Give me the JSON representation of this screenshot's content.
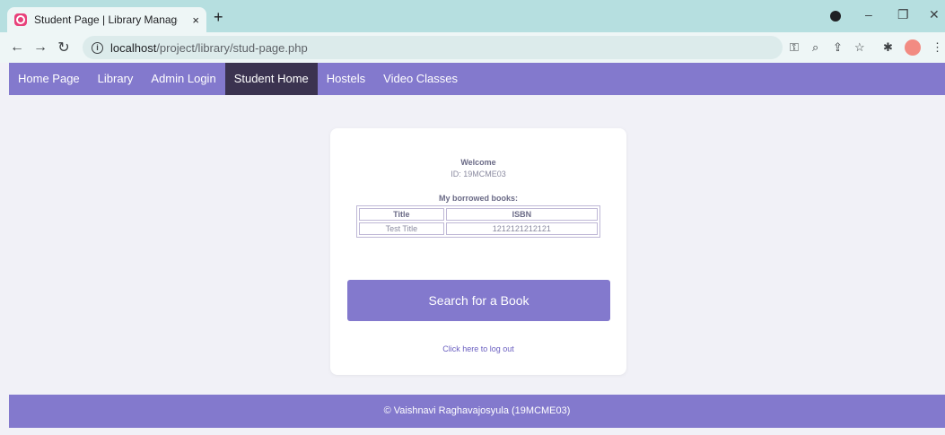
{
  "browser": {
    "tab_title": "Student Page | Library Managem",
    "tab_close": "×",
    "new_tab": "+",
    "url_host": "localhost",
    "url_path": "/project/library/stud-page.php"
  },
  "icons": [
    "favicon-icon",
    "close-icon",
    "plus-icon",
    "back-icon",
    "forward-icon",
    "reload-icon",
    "info-icon",
    "key-icon",
    "zoom-icon",
    "share-icon",
    "star-icon",
    "puzzle-icon",
    "minimize-icon",
    "restore-icon",
    "close-window-icon"
  ],
  "colors": {
    "accent": "#8379cd",
    "active_nav": "#3b3350",
    "page_bg": "#f1f1f7",
    "tabbar": "#b6dfe0"
  },
  "nav": {
    "items": [
      {
        "label": "Home Page",
        "active": false
      },
      {
        "label": "Library",
        "active": false
      },
      {
        "label": "Admin Login",
        "active": false
      },
      {
        "label": "Student Home",
        "active": true
      },
      {
        "label": "Hostels",
        "active": false
      },
      {
        "label": "Video Classes",
        "active": false
      }
    ]
  },
  "card": {
    "welcome": "Welcome",
    "user_id": "ID: 19MCME03",
    "borrowed_heading": "My borrowed books:",
    "table": {
      "headers": [
        "Title",
        "ISBN"
      ],
      "rows": [
        [
          "Test Title",
          "1212121212121"
        ]
      ]
    },
    "search_button": "Search for a Book",
    "logout_link": "Click here to log out"
  },
  "footer": {
    "text": "© Vaishnavi Raghavajosyula (19MCME03)"
  }
}
